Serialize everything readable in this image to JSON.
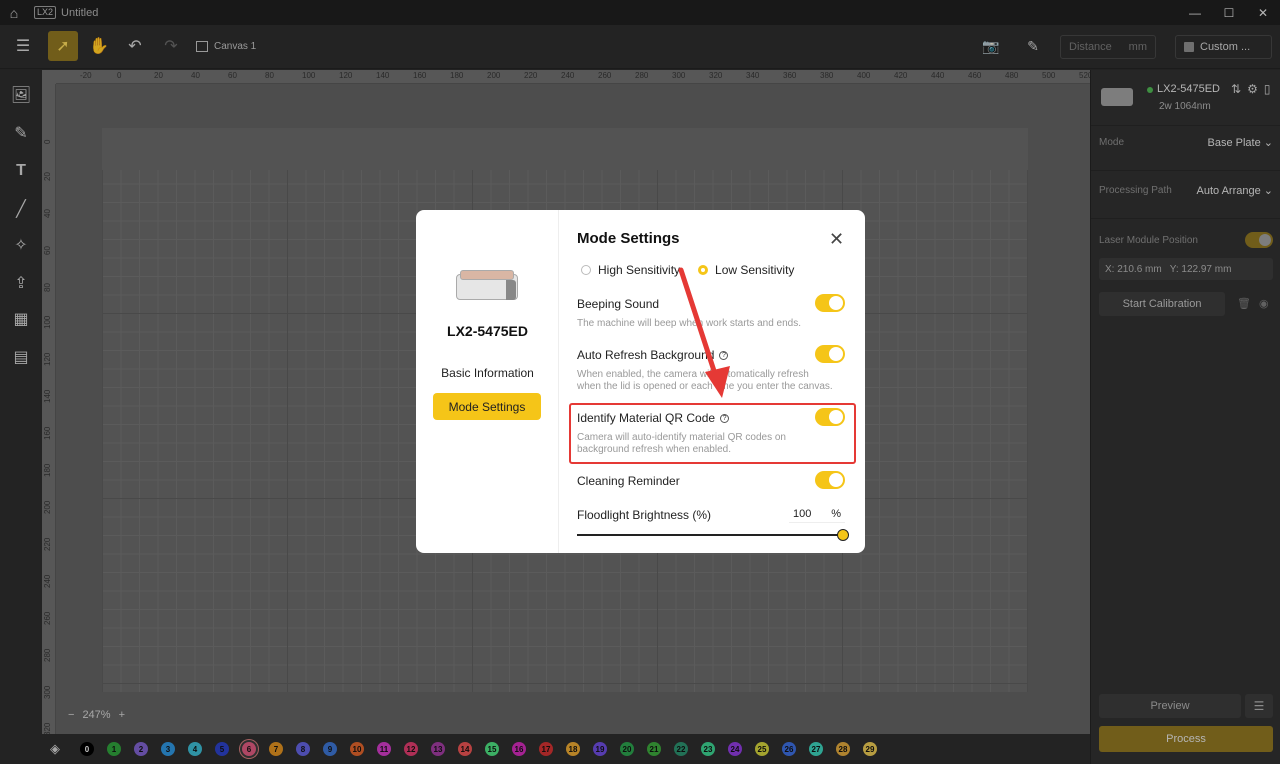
{
  "window": {
    "logo": "LX2",
    "title": "Untitled",
    "minimize": "—",
    "maximize": "☐",
    "close": "✕"
  },
  "toolbar": {
    "canvas_label": "Canvas 1",
    "distance_placeholder": "Distance",
    "distance_unit": "mm",
    "custom_label": "Custom ..."
  },
  "ruler": {
    "top": [
      "-20",
      "0",
      "20",
      "40",
      "60",
      "80",
      "100",
      "120",
      "140",
      "160",
      "180",
      "200",
      "220",
      "240",
      "260",
      "280",
      "300",
      "320",
      "340",
      "360",
      "380",
      "400",
      "420",
      "440",
      "460",
      "480",
      "500",
      "520"
    ],
    "left": [
      "0",
      "20",
      "40",
      "60",
      "80",
      "100",
      "120",
      "140",
      "160",
      "180",
      "200",
      "220",
      "240",
      "260",
      "280",
      "300",
      "320"
    ]
  },
  "zoom": {
    "minus": "−",
    "value": "247%",
    "plus": "+"
  },
  "colors": [
    {
      "n": "0",
      "c": "#000000"
    },
    {
      "n": "1",
      "c": "#2e9a3a"
    },
    {
      "n": "2",
      "c": "#7a5fc6"
    },
    {
      "n": "3",
      "c": "#2d8fd6"
    },
    {
      "n": "4",
      "c": "#3ab3c9"
    },
    {
      "n": "5",
      "c": "#2a3fbf"
    },
    {
      "n": "6",
      "c": "#d6577a"
    },
    {
      "n": "7",
      "c": "#d68a1f"
    },
    {
      "n": "8",
      "c": "#5f5fd6"
    },
    {
      "n": "9",
      "c": "#3a6fc9"
    },
    {
      "n": "10",
      "c": "#d6602a"
    },
    {
      "n": "11",
      "c": "#c93abf"
    },
    {
      "n": "12",
      "c": "#d63a6a"
    },
    {
      "n": "13",
      "c": "#9a3a9a"
    },
    {
      "n": "14",
      "c": "#e05050"
    },
    {
      "n": "15",
      "c": "#4ad67a"
    },
    {
      "n": "16",
      "c": "#c92ab3"
    },
    {
      "n": "17",
      "c": "#c93030"
    },
    {
      "n": "18",
      "c": "#e0a030"
    },
    {
      "n": "19",
      "c": "#6a4ad6"
    },
    {
      "n": "20",
      "c": "#2a9a4a"
    },
    {
      "n": "21",
      "c": "#3aa03a"
    },
    {
      "n": "22",
      "c": "#2a8a6a"
    },
    {
      "n": "23",
      "c": "#3ac98a"
    },
    {
      "n": "24",
      "c": "#8a3ad6"
    },
    {
      "n": "25",
      "c": "#c9c93a"
    },
    {
      "n": "26",
      "c": "#3a6ad6"
    },
    {
      "n": "27",
      "c": "#3ac9b3"
    },
    {
      "n": "28",
      "c": "#d6a03a"
    },
    {
      "n": "29",
      "c": "#e0c050"
    }
  ],
  "right_panel": {
    "device_name": "LX2-5475ED",
    "device_sub": "2w 1064nm",
    "mode_label": "Mode",
    "mode_value": "Base Plate",
    "path_label": "Processing Path",
    "path_value": "Auto Arrange",
    "laser_label": "Laser Module Position",
    "coord_x": "X: 210.6 mm",
    "coord_y": "Y: 122.97 mm",
    "calibration": "Start Calibration",
    "preview": "Preview",
    "menu": "☰",
    "process": "Process"
  },
  "modal": {
    "device_name": "LX2-5475ED",
    "basic_info": "Basic Information",
    "mode_settings_btn": "Mode Settings",
    "title": "Mode Settings",
    "close": "✕",
    "radio_high": "High Sensitivity",
    "radio_low": "Low Sensitivity",
    "selected_sensitivity": "low",
    "beeping_label": "Beeping Sound",
    "beeping_desc": "The machine will beep when work starts and ends.",
    "beeping_on": true,
    "autorefresh_label": "Auto Refresh Background",
    "autorefresh_desc": "When enabled, the camera will automatically refresh when the lid is opened or each time you enter the canvas.",
    "autorefresh_on": true,
    "qr_label": "Identify Material QR Code",
    "qr_desc": "Camera will auto-identify material QR codes on background refresh when enabled.",
    "qr_on": true,
    "cleaning_label": "Cleaning Reminder",
    "cleaning_on": true,
    "brightness_label": "Floodlight Brightness (%)",
    "brightness_value": "100",
    "brightness_unit": "%",
    "brightness_fraction": 1.0
  },
  "annotation_color": "#e53935"
}
